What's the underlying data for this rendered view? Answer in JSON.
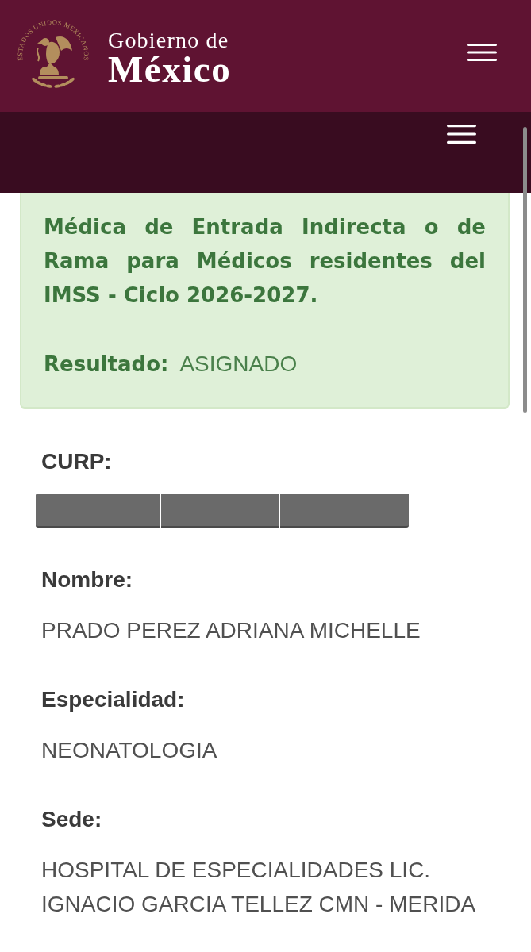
{
  "header": {
    "seal_text": "ESTADOS UNIDOS MEXICANOS",
    "title_line_1": "Gobierno de",
    "title_line_2": "México"
  },
  "result": {
    "description": "Médica de Entrada Indirecta o de Rama para Médicos residentes del IMSS - Ciclo 2026-2027.",
    "label": "Resultado:",
    "value": "ASIGNADO"
  },
  "fields": [
    {
      "kind": "redacted",
      "label": "CURP:"
    },
    {
      "kind": "text",
      "label": "Nombre:",
      "value": "PRADO PEREZ ADRIANA MICHELLE"
    },
    {
      "kind": "text",
      "label": "Especialidad:",
      "value": "NEONATOLOGIA"
    },
    {
      "kind": "text",
      "label": "Sede:",
      "value": "HOSPITAL DE ESPECIALIDADES LIC. IGNACIO GARCIA TELLEZ CMN - MERIDA"
    }
  ]
}
